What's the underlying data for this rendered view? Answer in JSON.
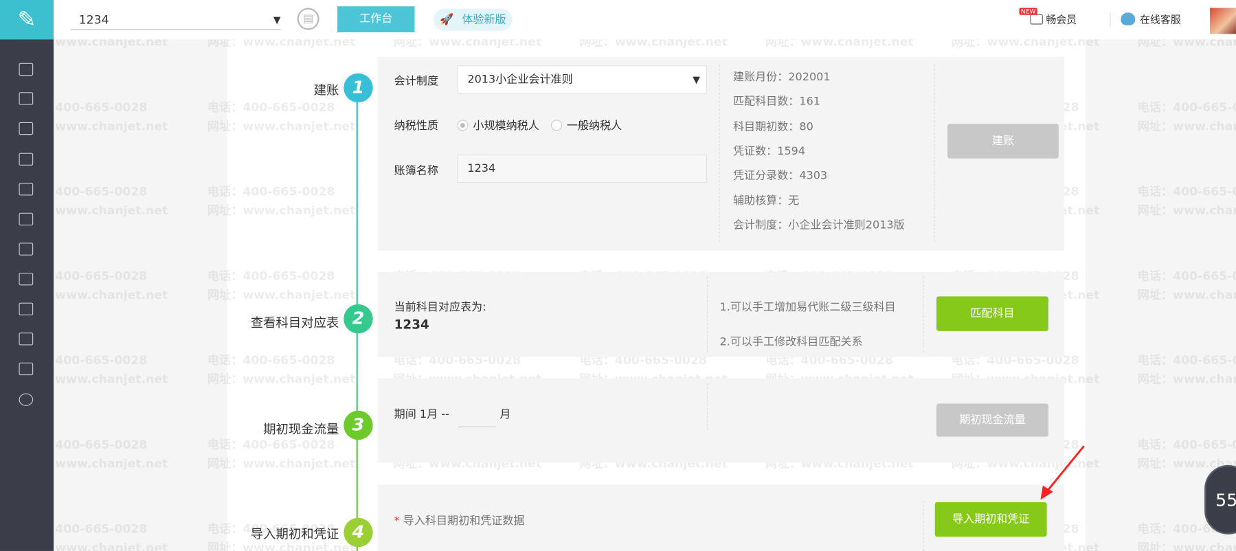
{
  "header": {
    "book_name": "1234",
    "workbench_label": "工作台",
    "new_version_label": "体验新版",
    "vip_badge": "NEW",
    "vip_label": "畅会员",
    "service_label": "在线客服"
  },
  "watermark": {
    "phone": "电话：400-665-0028",
    "site": "网址：www.chanjet.net"
  },
  "sidebar": {
    "icons": [
      "search-voucher-icon",
      "ledger-icon",
      "cash-icon",
      "chart-icon",
      "building-icon",
      "calendar-icon",
      "book-icon",
      "report-icon",
      "image-icon",
      "stamp-icon",
      "export-icon",
      "gear-icon"
    ]
  },
  "steps": [
    {
      "num": "1",
      "label": "建账"
    },
    {
      "num": "2",
      "label": "查看科目对应表"
    },
    {
      "num": "3",
      "label": "期初现金流量"
    },
    {
      "num": "4",
      "label": "导入期初和凭证"
    }
  ],
  "step1": {
    "system_label": "会计制度",
    "system_value": "2013小企业会计准则",
    "tax_label": "纳税性质",
    "tax_options": [
      "小规模纳税人",
      "一般纳税人"
    ],
    "tax_selected": "小规模纳税人",
    "name_label": "账簿名称",
    "name_value": "1234",
    "info": [
      "建账月份：202001",
      "匹配科目数：161",
      "科目期初数：80",
      "凭证数：1594",
      "凭证分录数：4303",
      "辅助核算：无",
      "会计制度：小企业会计准则2013版"
    ],
    "button": "建账"
  },
  "step2": {
    "current_label": "当前科目对应表为:",
    "current_value": "1234",
    "notes": [
      "1.可以手工增加易代账二级三级科目",
      "2.可以手工修改科目匹配关系"
    ],
    "button": "匹配科目"
  },
  "step3": {
    "period_prefix": "期间 1月 --",
    "period_value": "",
    "period_suffix": "月",
    "button": "期初现金流量"
  },
  "step4": {
    "required_mark": "*",
    "hint": "导入科目期初和凭证数据",
    "button": "导入期初和凭证"
  },
  "timer": "55",
  "colors": {
    "accent": "#4ec4d7",
    "green": "#86c91a",
    "sidebar": "#3b3e48",
    "annotation_arrow": "#ff2020"
  }
}
